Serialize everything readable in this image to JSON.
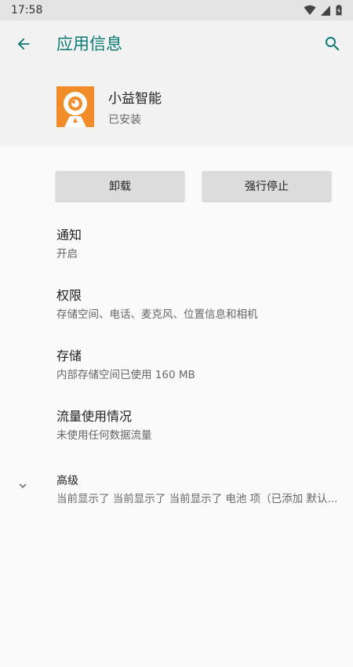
{
  "status_bar": {
    "time": "17:58",
    "icons": [
      "wifi-icon",
      "signal-icon",
      "battery-icon"
    ]
  },
  "app_bar": {
    "title": "应用信息",
    "back_icon": "arrow-back-icon",
    "search_icon": "search-icon",
    "accent_color": "#0b7a73"
  },
  "app": {
    "name": "小益智能",
    "state": "已安装",
    "icon_color": "#f28c28"
  },
  "actions": {
    "uninstall_label": "卸载",
    "force_stop_label": "强行停止"
  },
  "settings": [
    {
      "title": "通知",
      "subtitle": "开启"
    },
    {
      "title": "权限",
      "subtitle": "存储空间、电话、麦克风、位置信息和相机"
    },
    {
      "title": "存储",
      "subtitle": "内部存储空间已使用 160 MB"
    },
    {
      "title": "流量使用情况",
      "subtitle": "未使用任何数据流量"
    },
    {
      "title": "高级",
      "subtitle": "当前显示了 当前显示了 当前显示了 电池 项（已添加 默认..."
    }
  ]
}
